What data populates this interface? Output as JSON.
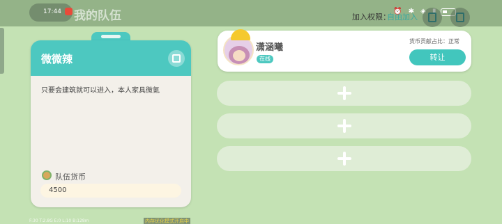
{
  "status_bar": {
    "time": "17:44",
    "page_title": "我的队伍",
    "join_permission_label": "加入权限：",
    "join_permission_value": "自由加入",
    "status_icons": "⏰ ✱ ◈ ▮"
  },
  "team_card": {
    "name": "微微辣",
    "description": "只要会建筑就可以进入，本人家具微氪",
    "currency_label": "队伍货币",
    "currency_value": "4500"
  },
  "member": {
    "name": "潇涵曦",
    "status": "在线",
    "contribution": "货币贡献占比：正常",
    "transfer_label": "转让"
  },
  "empty_slots": [
    {
      "label": "+"
    },
    {
      "label": "+"
    },
    {
      "label": "+"
    }
  ],
  "debug_stats": "F:30  T:2.8G  E:0  L:10  B:128m",
  "optimize_notice": "内存优化模式开启中",
  "colors": {
    "accent": "#4dc8c0",
    "background": "#c4e2b4",
    "card": "#f3f0ea"
  }
}
